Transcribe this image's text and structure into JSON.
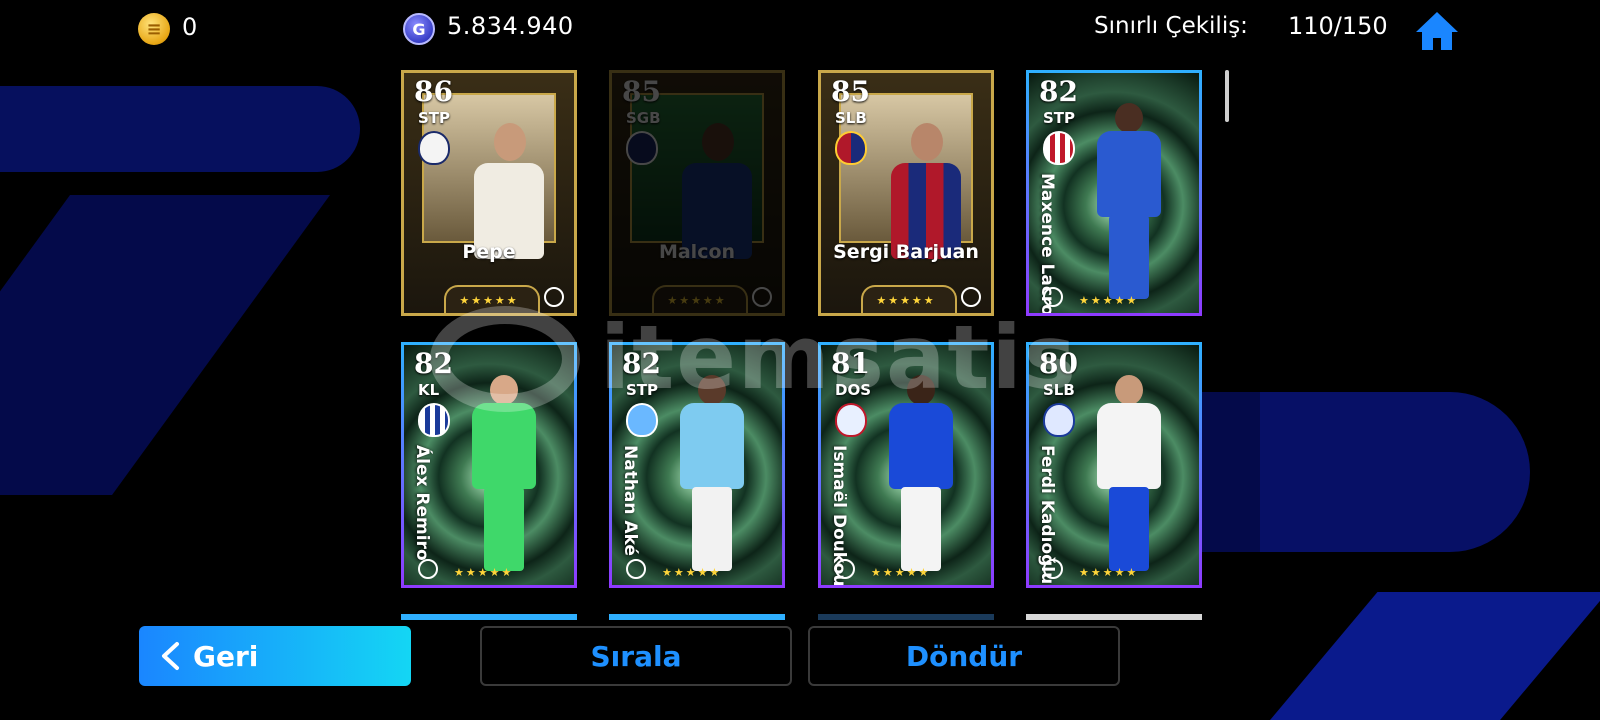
{
  "header": {
    "coins": "0",
    "gp": "5.834.940",
    "draw_label": "Sınırlı Çekiliş:",
    "draw_count": "110/150"
  },
  "cards": [
    {
      "rating": "86",
      "position": "STP",
      "name": "Pepe",
      "type": "gold"
    },
    {
      "rating": "85",
      "position": "SGB",
      "name": "Malcon",
      "type": "gold-dim"
    },
    {
      "rating": "85",
      "position": "SLB",
      "name": "Sergi Barjuan",
      "type": "gold"
    },
    {
      "rating": "82",
      "position": "STP",
      "name": "Maxence Lacroix",
      "type": "blue"
    },
    {
      "rating": "82",
      "position": "KL",
      "name": "Álex Remiro",
      "type": "blue"
    },
    {
      "rating": "82",
      "position": "STP",
      "name": "Nathan Aké",
      "type": "blue"
    },
    {
      "rating": "81",
      "position": "DOS",
      "name": "Ismaël Doukouré",
      "type": "blue"
    },
    {
      "rating": "80",
      "position": "SLB",
      "name": "Ferdi Kadıoğlu",
      "type": "blue"
    }
  ],
  "stars": "★★★★★",
  "watermark": "itemsatis",
  "buttons": {
    "back": "Geri",
    "sort": "Sırala",
    "rotate": "Döndür"
  },
  "colors": {
    "accent": "#1e90ff",
    "gold_frame": "#c9a84a",
    "star": "#ffd53a"
  },
  "icons": [
    "efootball-coin-icon",
    "gp-icon",
    "home-icon",
    "chevron-left-icon",
    "efootball-logo-icon"
  ]
}
